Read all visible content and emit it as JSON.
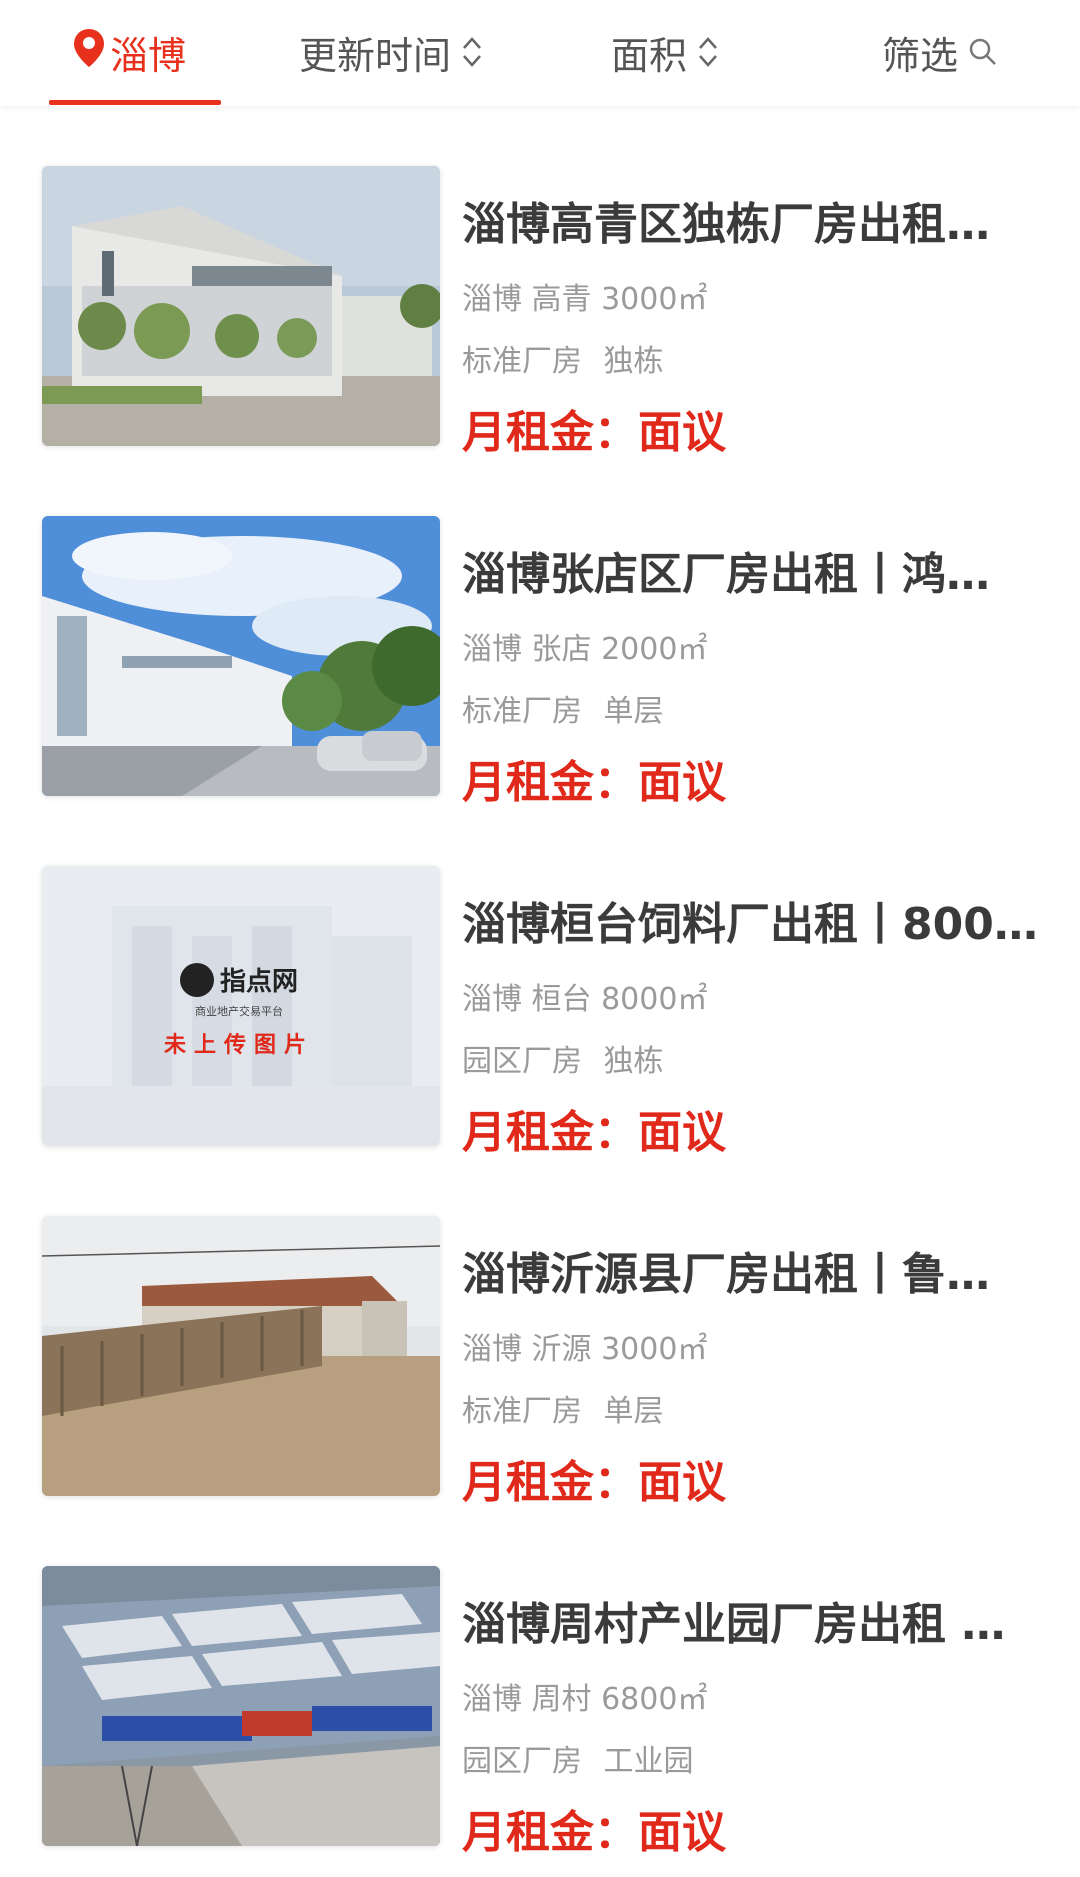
{
  "filter_bar": {
    "city": "淄博",
    "update_time": "更新时间",
    "area": "面积",
    "filter": "筛选"
  },
  "listings": [
    {
      "title": "淄博高青区独栋厂房出租…",
      "meta": "淄博 高青 3000㎡",
      "tags": [
        "标准厂房",
        "独栋"
      ],
      "price": "月租金：面议"
    },
    {
      "title": "淄博张店区厂房出租丨鸿…",
      "meta": "淄博 张店 2000㎡",
      "tags": [
        "标准厂房",
        "单层"
      ],
      "price": "月租金：面议"
    },
    {
      "title": "淄博桓台饲料厂出租丨800…",
      "meta": "淄博 桓台 8000㎡",
      "tags": [
        "园区厂房",
        "独栋"
      ],
      "price": "月租金：面议",
      "placeholder": {
        "logo": "指点网",
        "subtitle": "商业地产交易平台",
        "text": "未上传图片"
      }
    },
    {
      "title": "淄博沂源县厂房出租丨鲁…",
      "meta": "淄博 沂源 3000㎡",
      "tags": [
        "标准厂房",
        "单层"
      ],
      "price": "月租金：面议"
    },
    {
      "title": "淄博周村产业园厂房出租 …",
      "meta": "淄博 周村 6800㎡",
      "tags": [
        "园区厂房",
        "工业园"
      ],
      "price": "月租金：面议"
    }
  ],
  "colors": {
    "accent": "#e8311c",
    "price": "#e0291a",
    "muted": "#9a9a9a"
  },
  "icons": {
    "city": "location-pin-icon",
    "sort": "sort-updown-icon",
    "filter": "search-icon"
  }
}
